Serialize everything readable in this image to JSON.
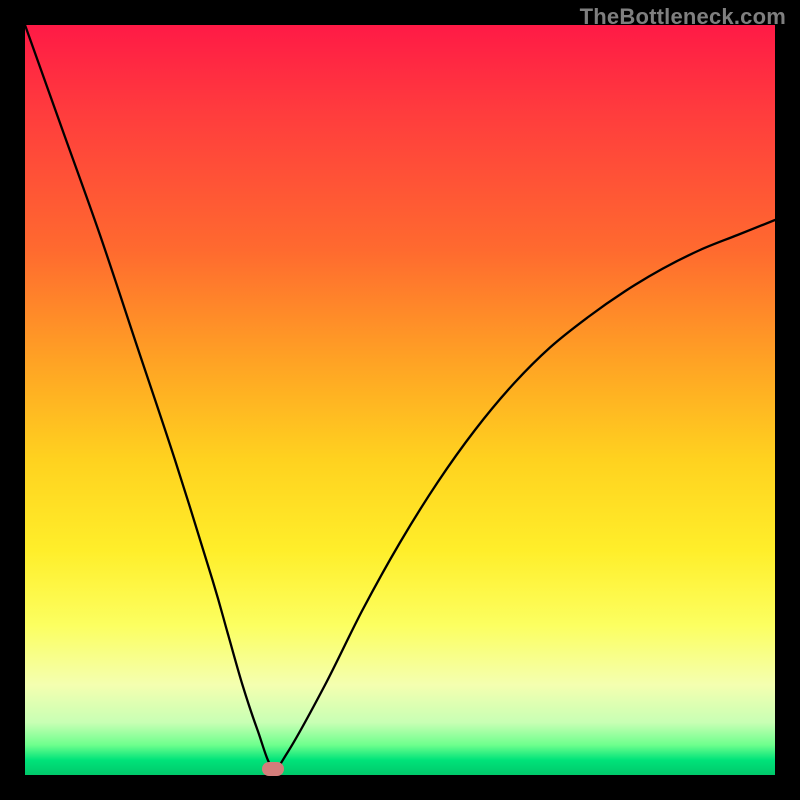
{
  "watermark": "TheBottleneck.com",
  "chart_data": {
    "type": "line",
    "title": "",
    "xlabel": "",
    "ylabel": "",
    "xlim": [
      0,
      100
    ],
    "ylim": [
      0,
      100
    ],
    "grid": false,
    "legend": false,
    "gradient_stops": [
      {
        "pos": 0,
        "color": "#ff1a46"
      },
      {
        "pos": 12,
        "color": "#ff3d3d"
      },
      {
        "pos": 30,
        "color": "#ff6a2f"
      },
      {
        "pos": 45,
        "color": "#ffa324"
      },
      {
        "pos": 58,
        "color": "#ffd21f"
      },
      {
        "pos": 70,
        "color": "#ffee2a"
      },
      {
        "pos": 80,
        "color": "#fcff60"
      },
      {
        "pos": 88,
        "color": "#f4ffb0"
      },
      {
        "pos": 93,
        "color": "#c8ffb4"
      },
      {
        "pos": 96,
        "color": "#6eff8d"
      },
      {
        "pos": 98,
        "color": "#00e37a"
      },
      {
        "pos": 100,
        "color": "#00c86a"
      }
    ],
    "series": [
      {
        "name": "bottleneck-curve",
        "x": [
          0,
          5,
          10,
          15,
          20,
          25,
          27,
          29,
          31,
          33,
          35,
          40,
          45,
          50,
          55,
          60,
          65,
          70,
          75,
          80,
          85,
          90,
          95,
          100
        ],
        "y": [
          100,
          86,
          72,
          57,
          42,
          26,
          19,
          12,
          6,
          1,
          3,
          12,
          22,
          31,
          39,
          46,
          52,
          57,
          61,
          64.5,
          67.5,
          70,
          72,
          74
        ]
      }
    ],
    "marker": {
      "x": 33,
      "y": 0.8
    }
  }
}
